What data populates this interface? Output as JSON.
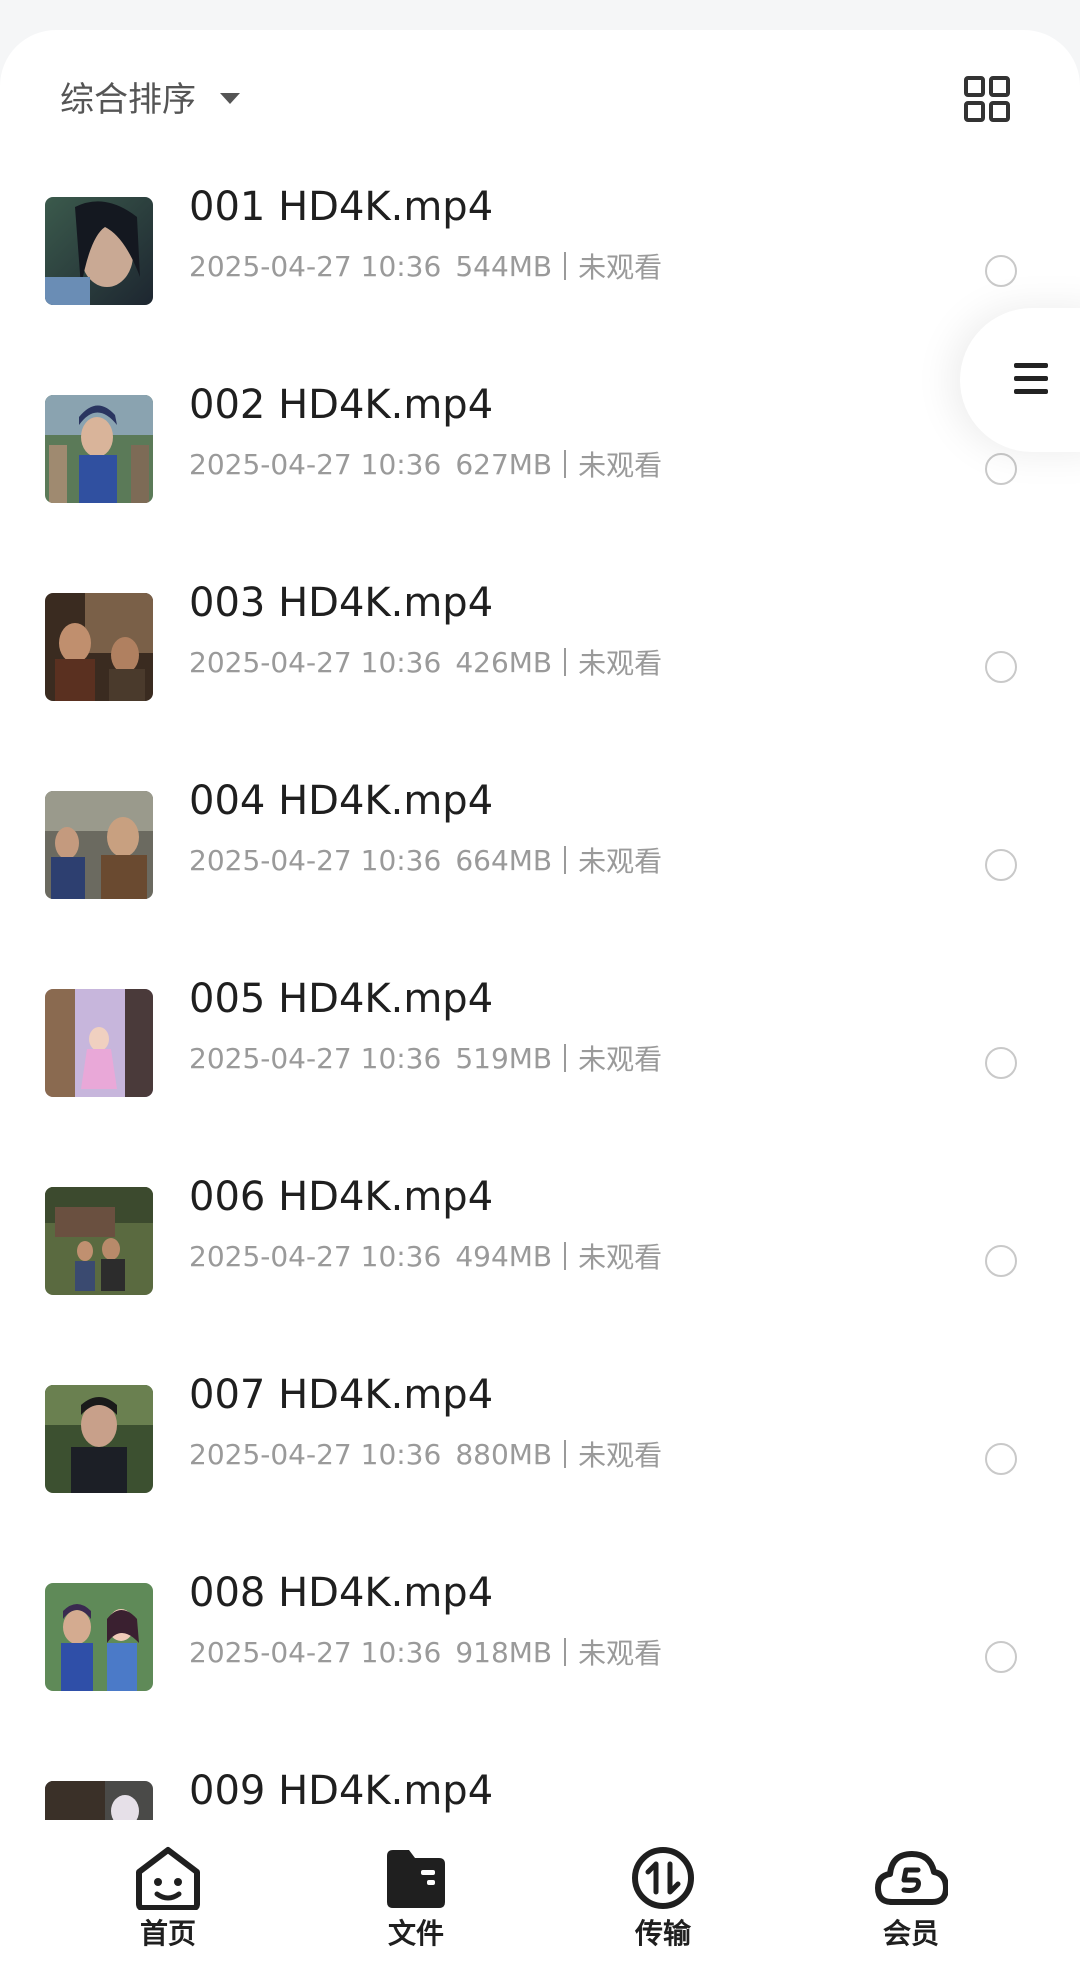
{
  "sort": {
    "label": "综合排序",
    "caret_icon": "caret-down-icon",
    "view_toggle_icon": "grid-view-icon"
  },
  "files": [
    {
      "name": "001 HD4K.mp4",
      "date": "2025-04-27 10:36",
      "size": "544MB",
      "status": "未观看"
    },
    {
      "name": "002 HD4K.mp4",
      "date": "2025-04-27 10:36",
      "size": "627MB",
      "status": "未观看"
    },
    {
      "name": "003 HD4K.mp4",
      "date": "2025-04-27 10:36",
      "size": "426MB",
      "status": "未观看"
    },
    {
      "name": "004 HD4K.mp4",
      "date": "2025-04-27 10:36",
      "size": "664MB",
      "status": "未观看"
    },
    {
      "name": "005 HD4K.mp4",
      "date": "2025-04-27 10:36",
      "size": "519MB",
      "status": "未观看"
    },
    {
      "name": "006 HD4K.mp4",
      "date": "2025-04-27 10:36",
      "size": "494MB",
      "status": "未观看"
    },
    {
      "name": "007 HD4K.mp4",
      "date": "2025-04-27 10:36",
      "size": "880MB",
      "status": "未观看"
    },
    {
      "name": "008 HD4K.mp4",
      "date": "2025-04-27 10:36",
      "size": "918MB",
      "status": "未观看"
    },
    {
      "name": "009 HD4K.mp4",
      "date": "",
      "size": "",
      "status": ""
    }
  ],
  "float_menu": {
    "icon": "menu-icon"
  },
  "nav": [
    {
      "label": "首页",
      "icon": "smile-home-icon"
    },
    {
      "label": "文件",
      "icon": "folder-icon",
      "active": true
    },
    {
      "label": "传输",
      "icon": "transfer-icon"
    },
    {
      "label": "会员",
      "icon": "cloud-vip-icon"
    }
  ],
  "colors": {
    "text_primary": "#1f1f1f",
    "text_secondary": "#9a9a9a",
    "radio_border": "#c9c9c9",
    "background": "#f5f6f7"
  }
}
